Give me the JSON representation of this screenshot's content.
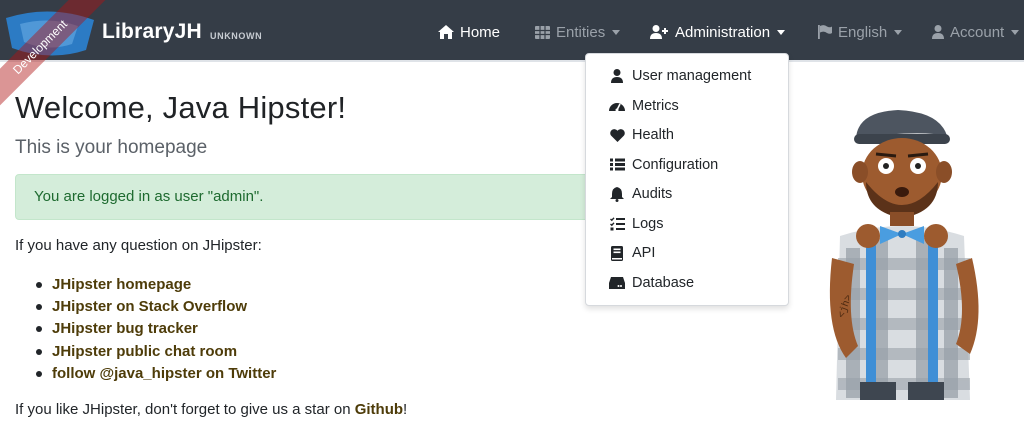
{
  "navbar": {
    "brand": "LibraryJH",
    "version": "UNKNOWN",
    "ribbon": "Development",
    "items": {
      "home": "Home",
      "entities": "Entities",
      "administration": "Administration",
      "language": "English",
      "account": "Account"
    },
    "colors": {
      "background": "#353d47",
      "text": "#ffffff",
      "muted": "#9aa1a9"
    }
  },
  "admin_menu": {
    "items": [
      {
        "label": "User management",
        "icon": "user-icon"
      },
      {
        "label": "Metrics",
        "icon": "tachometer-icon"
      },
      {
        "label": "Health",
        "icon": "heart-icon"
      },
      {
        "label": "Configuration",
        "icon": "list-icon"
      },
      {
        "label": "Audits",
        "icon": "bell-icon"
      },
      {
        "label": "Logs",
        "icon": "tasks-icon"
      },
      {
        "label": "API",
        "icon": "book-icon"
      },
      {
        "label": "Database",
        "icon": "hdd-icon"
      }
    ]
  },
  "main": {
    "title": "Welcome, Java Hipster!",
    "subtitle": "This is your homepage",
    "alert": "You are logged in as user \"admin\".",
    "question": "If you have any question on JHipster:",
    "links": [
      "JHipster homepage",
      "JHipster on Stack Overflow",
      "JHipster bug tracker",
      "JHipster public chat room",
      "follow @java_hipster on Twitter"
    ],
    "footer_prefix": "If you like JHipster, don't forget to give us a star on ",
    "footer_link": "Github",
    "footer_suffix": "!",
    "colors": {
      "alert_bg": "#d4edda",
      "alert_text": "#1d6a2f",
      "link": "#4e3c09"
    }
  }
}
